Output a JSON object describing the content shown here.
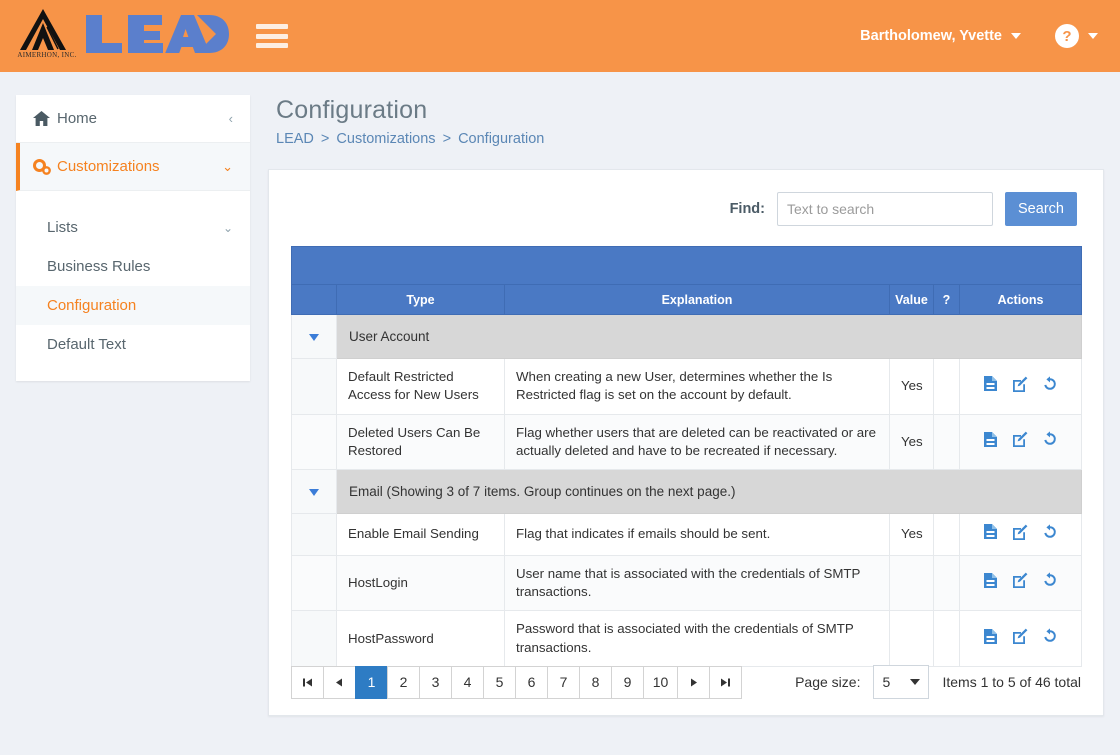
{
  "brand": {
    "company": "AIMERHON, INC.",
    "product": "LEAD",
    "menu_icon": "hamburger-icon"
  },
  "header": {
    "user_name": "Bartholomew, Yvette",
    "help_label": "?",
    "accent_color": "#f79448"
  },
  "sidebar": {
    "items": [
      {
        "label": "Home",
        "icon": "home-icon",
        "chevron": "‹"
      },
      {
        "label": "Customizations",
        "icon": "gears-icon",
        "chevron": "⌄"
      }
    ],
    "subitems": [
      {
        "label": "Lists",
        "chevron": "⌄",
        "active": false
      },
      {
        "label": "Business Rules",
        "chevron": "",
        "active": false
      },
      {
        "label": "Configuration",
        "chevron": "",
        "active": true
      },
      {
        "label": "Default Text",
        "chevron": "",
        "active": false
      }
    ]
  },
  "page": {
    "title": "Configuration",
    "breadcrumb": [
      "LEAD",
      "Customizations",
      "Configuration"
    ],
    "breadcrumb_sep": ">"
  },
  "search": {
    "find_label": "Find:",
    "placeholder": "Text to search",
    "value": "",
    "button_label": "Search"
  },
  "table": {
    "columns": [
      "",
      "Type",
      "Explanation",
      "Value",
      "?",
      "Actions"
    ],
    "header_color": "#4a79c4",
    "action_icons": [
      "document-icon",
      "edit-icon",
      "history-icon"
    ],
    "groups": [
      {
        "label": "User Account",
        "rows": [
          {
            "type": "Default Restricted Access for New Users",
            "explanation": "When creating a new User, determines whether the Is Restricted flag is set on the account by default.",
            "value": "Yes",
            "q": ""
          },
          {
            "type": "Deleted Users Can Be Restored",
            "explanation": "Flag whether users that are deleted can be reactivated or are actually deleted and have to be recreated if necessary.",
            "value": "Yes",
            "q": ""
          }
        ]
      },
      {
        "label": "Email (Showing 3 of 7 items. Group continues on the next page.)",
        "rows": [
          {
            "type": "Enable Email Sending",
            "explanation": "Flag that indicates if emails should be sent.",
            "value": "Yes",
            "q": ""
          },
          {
            "type": "HostLogin",
            "explanation": "User name that is associated with the credentials of SMTP transactions.",
            "value": "",
            "q": ""
          },
          {
            "type": "HostPassword",
            "explanation": "Password that is associated with the credentials of SMTP transactions.",
            "value": "",
            "q": ""
          }
        ]
      }
    ]
  },
  "pager": {
    "first": "⏮",
    "prev": "◀",
    "next": "▶",
    "last": "⏭",
    "pages": [
      "1",
      "2",
      "3",
      "4",
      "5",
      "6",
      "7",
      "8",
      "9",
      "10"
    ],
    "active_page": "1",
    "page_size_label": "Page size:",
    "page_size_value": "5",
    "items_total": "Items 1 to 5 of 46 total"
  }
}
